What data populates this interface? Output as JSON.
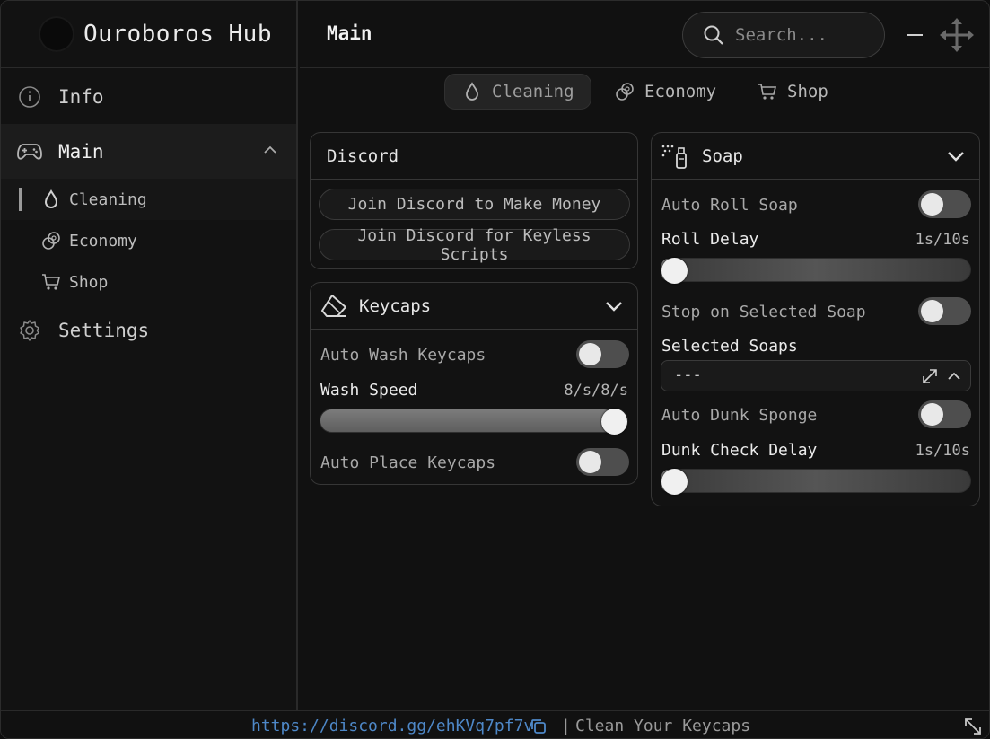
{
  "app": {
    "title": "Ouroboros Hub"
  },
  "sidebar": {
    "items": [
      {
        "label": "Info",
        "icon": "info-icon"
      },
      {
        "label": "Main",
        "icon": "gamepad-icon",
        "expanded": true,
        "children": [
          {
            "label": "Cleaning",
            "icon": "droplet-icon",
            "active": true
          },
          {
            "label": "Economy",
            "icon": "coins-icon"
          },
          {
            "label": "Shop",
            "icon": "cart-icon"
          }
        ]
      },
      {
        "label": "Settings",
        "icon": "gear-icon"
      }
    ]
  },
  "header": {
    "title": "Main",
    "search_placeholder": "Search..."
  },
  "tabs": [
    {
      "label": "Cleaning",
      "icon": "droplet-icon",
      "active": true
    },
    {
      "label": "Economy",
      "icon": "coins-icon"
    },
    {
      "label": "Shop",
      "icon": "cart-icon"
    }
  ],
  "discord_card": {
    "title": "Discord",
    "buttons": [
      "Join Discord to Make Money",
      "Join Discord for Keyless Scripts"
    ]
  },
  "keycaps_card": {
    "title": "Keycaps",
    "auto_wash": {
      "label": "Auto Wash Keycaps",
      "on": false
    },
    "wash_speed": {
      "label": "Wash Speed",
      "value_text": "8/s/8/s",
      "fraction": 1.0
    },
    "auto_place": {
      "label": "Auto Place Keycaps",
      "on": false
    }
  },
  "soap_card": {
    "title": "Soap",
    "auto_roll": {
      "label": "Auto Roll Soap",
      "on": false
    },
    "roll_delay": {
      "label": "Roll Delay",
      "value_text": "1s/10s",
      "fraction": 0.0
    },
    "stop_selected": {
      "label": "Stop on Selected Soap",
      "on": false
    },
    "selected_soaps": {
      "label": "Selected Soaps",
      "value": "---"
    },
    "auto_dunk": {
      "label": "Auto Dunk Sponge",
      "on": false
    },
    "dunk_delay": {
      "label": "Dunk Check Delay",
      "value_text": "1s/10s",
      "fraction": 0.0
    }
  },
  "footer": {
    "link": "https://discord.gg/ehKVq7pf7v",
    "separator": "|",
    "text": "Clean Your Keycaps"
  },
  "colors": {
    "link": "#4e88c8",
    "background": "#111111",
    "toggle_off": "#4e4e4e"
  }
}
